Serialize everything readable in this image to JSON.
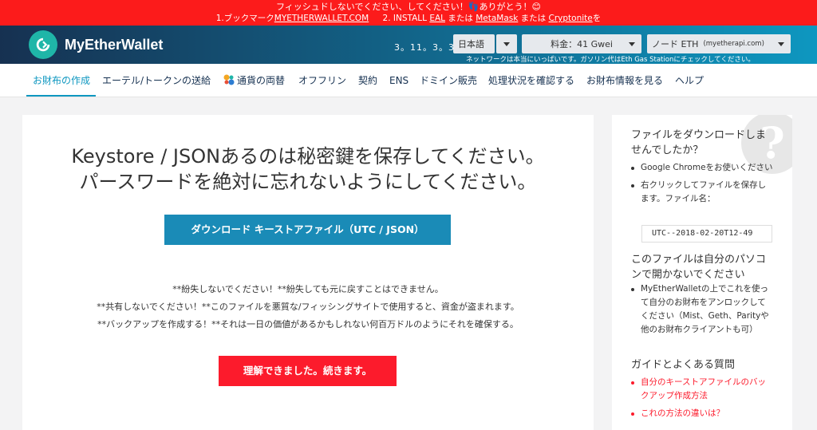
{
  "banner": {
    "line1": "フィッシュドしないでください、してください！👣ありがとう！😊",
    "step1_prefix": "1.ブックマーク",
    "step1_link": "MYETHERWALLET.COM",
    "step2_prefix": "2. INSTALL",
    "link_eal": "EAL",
    "or1": "または",
    "link_metamask": "MetaMask",
    "or2": "または",
    "link_cryptonite": "Cryptonite",
    "suffix": "を"
  },
  "header": {
    "app_name": "MyEtherWallet",
    "version": "3。11。3。3",
    "language": "日本語",
    "gas_label": "料金：41 Gwei",
    "node_prefix": "ノード",
    "node_network": "ETH",
    "node_provider": "(myetherapi.com)",
    "note": "ネットワークは本当にいっぱいです。ガソリン代はEth Gas Stationにチェックしてください。"
  },
  "nav": {
    "items": [
      {
        "label": "お財布の作成"
      },
      {
        "label": "エーテル/トークンの送給"
      },
      {
        "label": "通貨の両替"
      },
      {
        "label": "オフフリン"
      },
      {
        "label": "契約"
      },
      {
        "label": "ENS"
      },
      {
        "label": "ドミイン販売"
      },
      {
        "label": "処理状況を確認する"
      },
      {
        "label": "お財布情報を見る"
      },
      {
        "label": "ヘルプ"
      }
    ]
  },
  "main": {
    "title_line1": "Keystore / JSONあるのは秘密鍵を保存してください。",
    "title_line2": "パースワードを絶対に忘れないようにしてください。",
    "download_button": "ダウンロード キーストアファイル（UTC / JSON）",
    "warning1": "**紛失しないでください！**紛失しても元に戻すことはできません。",
    "warning2": "**共有しないでください！**このファイルを悪質な/フィッシングサイトで使用すると、資金が盗まれます。",
    "warning3": "**バックアップを作成する！**それは一日の価値があるかもしれない何百万ドルのようにそれを確保する。",
    "continue_button": "理解できました。続きます。"
  },
  "sidebar": {
    "badge": "?",
    "heading1": "ファイルをダウンロードしませんでしたか？",
    "tip1": "Google Chromeをお使いください",
    "tip2": "右クリックしてファイルを保存します。ファイル名：",
    "filename": "UTC--2018-02-20T12-49",
    "heading2": "このファイルは自分のパソコンで開かないでください",
    "tip3": "MyEtherWalletの上でこれを使って自分のお財布をアンロックしてください（Mist、Geth、Parityや他のお財布クライアントも可）",
    "heading3": "ガイドとよくある質問",
    "link1": "自分のキーストアファイルのバックアップ作成方法",
    "link2": "これの方法の違いは？"
  },
  "colors": {
    "banner_red": "#fc1b1b",
    "header_dark": "#163151",
    "header_light": "#0e97c0",
    "primary_button": "#1a8bb7",
    "danger_button": "#fc1b2c"
  }
}
